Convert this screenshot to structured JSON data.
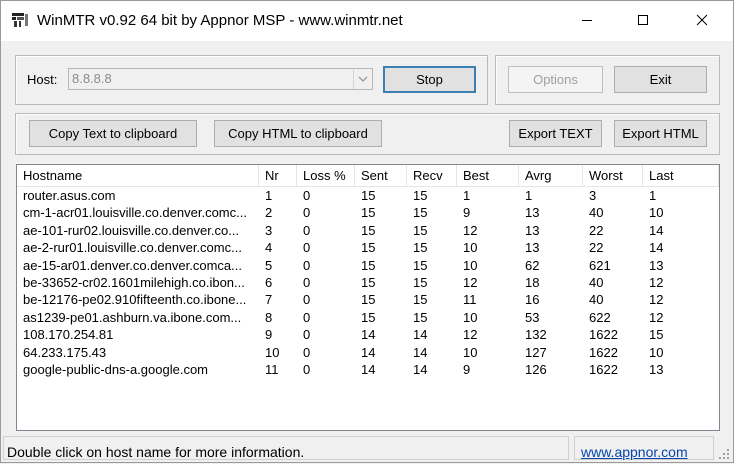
{
  "window": {
    "title": "WinMTR v0.92 64 bit by Appnor MSP - www.winmtr.net",
    "icon": "winmtr-app-icon",
    "controls": {
      "minimize": "minimize-icon",
      "maximize": "maximize-icon",
      "close": "close-icon"
    }
  },
  "host": {
    "label": "Host:",
    "value": "8.8.8.8",
    "dropdown_icon": "chevron-down-icon"
  },
  "buttons": {
    "stop": "Stop",
    "options": "Options",
    "exit": "Exit",
    "copy_text": "Copy Text to clipboard",
    "copy_html": "Copy HTML to clipboard",
    "export_text": "Export TEXT",
    "export_html": "Export HTML"
  },
  "table": {
    "columns": [
      "Hostname",
      "Nr",
      "Loss %",
      "Sent",
      "Recv",
      "Best",
      "Avrg",
      "Worst",
      "Last"
    ],
    "rows": [
      [
        "router.asus.com",
        "1",
        "0",
        "15",
        "15",
        "1",
        "1",
        "3",
        "1"
      ],
      [
        "cm-1-acr01.louisville.co.denver.comc...",
        "2",
        "0",
        "15",
        "15",
        "9",
        "13",
        "40",
        "10"
      ],
      [
        "ae-101-rur02.louisville.co.denver.co...",
        "3",
        "0",
        "15",
        "15",
        "12",
        "13",
        "22",
        "14"
      ],
      [
        "ae-2-rur01.louisville.co.denver.comc...",
        "4",
        "0",
        "15",
        "15",
        "10",
        "13",
        "22",
        "14"
      ],
      [
        "ae-15-ar01.denver.co.denver.comca...",
        "5",
        "0",
        "15",
        "15",
        "10",
        "62",
        "621",
        "13"
      ],
      [
        "be-33652-cr02.1601milehigh.co.ibon...",
        "6",
        "0",
        "15",
        "15",
        "12",
        "18",
        "40",
        "12"
      ],
      [
        "be-12176-pe02.910fifteenth.co.ibone...",
        "7",
        "0",
        "15",
        "15",
        "11",
        "16",
        "40",
        "12"
      ],
      [
        "as1239-pe01.ashburn.va.ibone.com...",
        "8",
        "0",
        "15",
        "15",
        "10",
        "53",
        "622",
        "12"
      ],
      [
        "108.170.254.81",
        "9",
        "0",
        "14",
        "14",
        "12",
        "132",
        "1622",
        "15"
      ],
      [
        "64.233.175.43",
        "10",
        "0",
        "14",
        "14",
        "10",
        "127",
        "1622",
        "10"
      ],
      [
        "google-public-dns-a.google.com",
        "11",
        "0",
        "14",
        "14",
        "9",
        "126",
        "1622",
        "13"
      ]
    ]
  },
  "status": {
    "message": "Double click on host name for more information.",
    "link": "www.appnor.com"
  }
}
